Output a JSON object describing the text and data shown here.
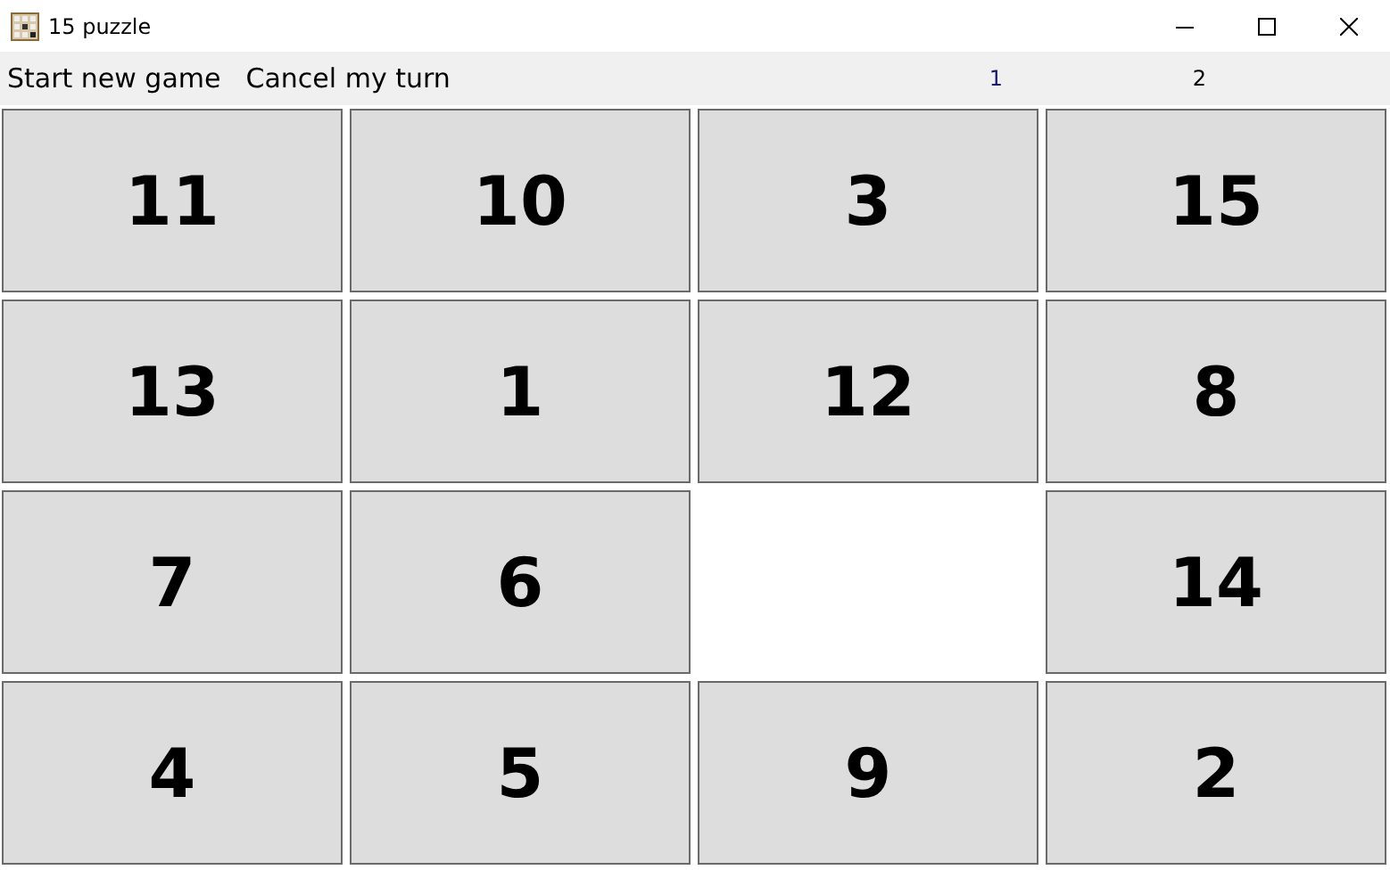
{
  "window": {
    "title": "15 puzzle"
  },
  "menu": [
    {
      "label": "Start new game"
    },
    {
      "label": "Cancel my turn"
    }
  ],
  "counters": [
    {
      "label": "1",
      "color": "#1a1a6e"
    },
    {
      "label": "2",
      "color": "#000000"
    }
  ],
  "tiles": [
    {
      "kind": "tile",
      "label": "11"
    },
    {
      "kind": "tile",
      "label": "10"
    },
    {
      "kind": "tile",
      "label": "3"
    },
    {
      "kind": "tile",
      "label": "15"
    },
    {
      "kind": "tile",
      "label": "13"
    },
    {
      "kind": "tile",
      "label": "1"
    },
    {
      "kind": "tile",
      "label": "12"
    },
    {
      "kind": "tile",
      "label": "8"
    },
    {
      "kind": "tile",
      "label": "7"
    },
    {
      "kind": "tile",
      "label": "6"
    },
    {
      "kind": "empty"
    },
    {
      "kind": "tile",
      "label": "14"
    },
    {
      "kind": "tile",
      "label": "4"
    },
    {
      "kind": "tile",
      "label": "5"
    },
    {
      "kind": "tile",
      "label": "9"
    },
    {
      "kind": "tile",
      "label": "2"
    }
  ]
}
